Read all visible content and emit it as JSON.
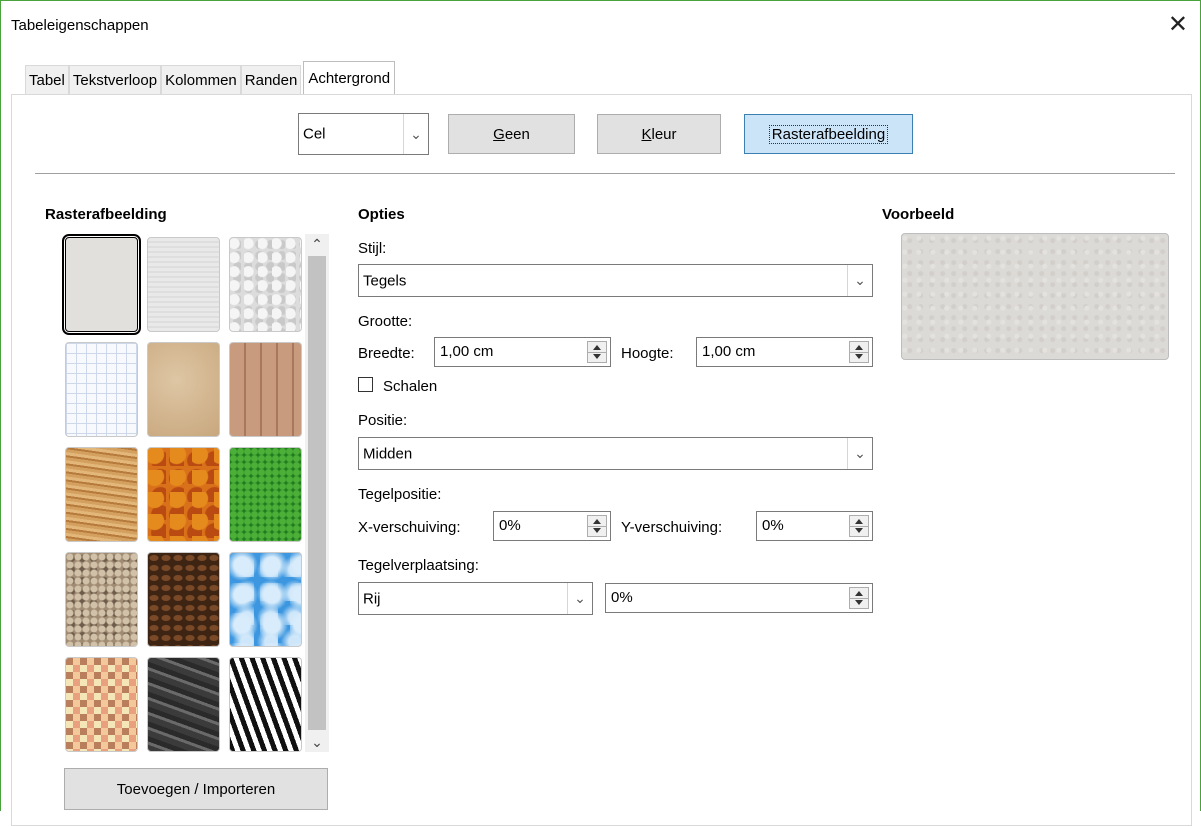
{
  "window": {
    "title": "Tabeleigenschappen",
    "close_glyph": "✕"
  },
  "tabs": [
    "Tabel",
    "Tekstverloop",
    "Kolommen",
    "Randen",
    "Achtergrond"
  ],
  "active_tab": "Achtergrond",
  "top": {
    "as_select": "Cel",
    "buttons": {
      "none": {
        "label": "Geen",
        "mnemonic": "G"
      },
      "color": {
        "label": "Kleur",
        "mnemonic": "K"
      },
      "bitmap": {
        "label": "Rasterafbeelding",
        "mnemonic": "R",
        "selected": true
      }
    }
  },
  "left": {
    "heading": "Rasterafbeelding",
    "tiles": [
      "painted-white",
      "paper-texture",
      "paper-crumpled",
      "grid-paper",
      "parchment",
      "fence",
      "wood",
      "maple-leaves",
      "grass",
      "pebbles",
      "coffee-beans",
      "sky",
      "mosaic",
      "stone",
      "zebra"
    ],
    "selected_tile": 0,
    "add_button": "Toevoegen / Importeren"
  },
  "options": {
    "heading": "Opties",
    "style_label": "Stijl:",
    "style_value": "Tegels",
    "size_label": "Grootte:",
    "width_label": "Breedte:",
    "width_value": "1,00 cm",
    "height_label": "Hoogte:",
    "height_value": "1,00 cm",
    "scale_label": "Schalen",
    "scale_checked": false,
    "position_label": "Positie:",
    "position_value": "Midden",
    "tile_pos_label": "Tegelpositie:",
    "x_offset_label": "X-verschuiving:",
    "x_offset_value": "0%",
    "y_offset_label": "Y-verschuiving:",
    "y_offset_value": "0%",
    "tile_offset_label": "Tegelverplaatsing:",
    "tile_offset_mode": "Rij",
    "tile_offset_value": "0%"
  },
  "preview": {
    "heading": "Voorbeeld"
  },
  "colors": {
    "accent_border": "#3c7fb1",
    "selected_button_bg": "#cce4f7",
    "window_border": "#4aa23a"
  }
}
